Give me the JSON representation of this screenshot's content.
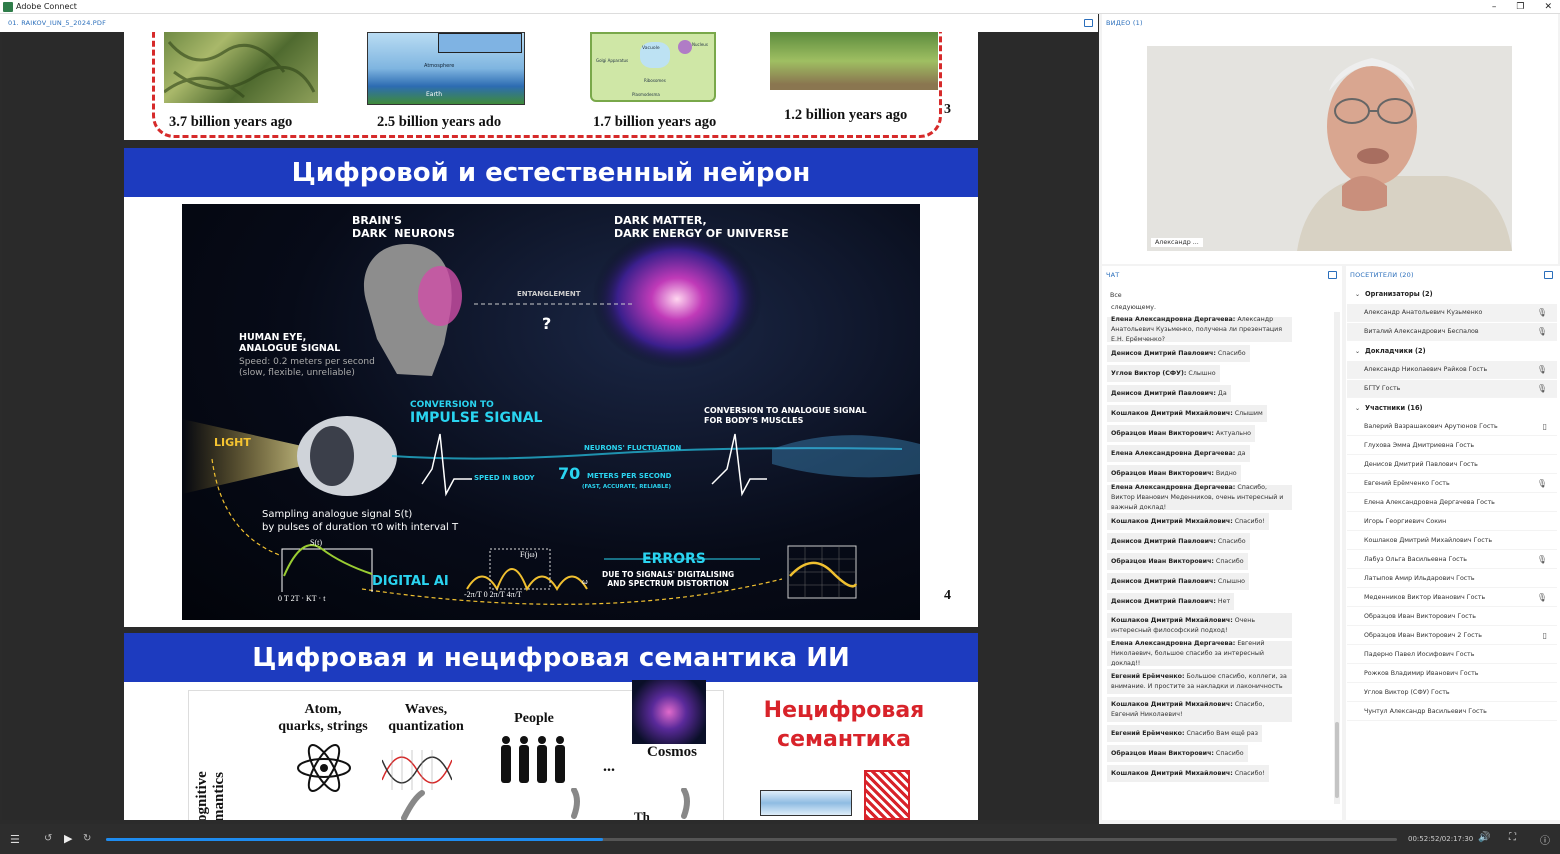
{
  "window": {
    "title": "Adobe Connect",
    "minimize": "–",
    "restore": "❐",
    "close": "✕"
  },
  "share_pod": {
    "title": "01. RAIKOV_IUN_5_2024.PDF"
  },
  "slide3": {
    "captions": [
      "3.7 billion years ago",
      "2.5 billion years ado",
      "1.7 billion years ago",
      "1.2 billion years ago"
    ],
    "page": "3",
    "diagram_labels": {
      "atmosphere": "Atmosphere",
      "earth": "Earth",
      "vacuole": "Vacuole",
      "golgi": "Golgi Apparatus",
      "nucleus": "Nucleus",
      "ribosomes": "Ribosomes",
      "plasmodesma": "Plasmodesma"
    }
  },
  "slide4": {
    "title": "Цифровой и естественный нейрон",
    "page": "4",
    "labels": {
      "brain": "BRAIN'S\nDARK  NEURONS",
      "matter": "DARK MATTER,\nDARK ENERGY OF UNIVERSE",
      "entanglement": "ENTANGLEMENT",
      "question": "?",
      "eye": "HUMAN EYE,\nANALOGUE SIGNAL",
      "eye_speed": "Speed: 0.2 meters per second\n(slow, flexible, unreliable)",
      "light": "LIGHT",
      "conv1": "CONVERSION TO",
      "conv2": "IMPULSE SIGNAL",
      "fluct": "NEURONS' FLUCTUATION",
      "speed1": "SPEED IN BODY",
      "speed2": "70",
      "speed3": "METERS PER SECOND",
      "speed4": "(FAST, ACCURATE, RELIABLE)",
      "conv3": "CONVERSION TO ANALOGUE SIGNAL\nFOR BODY'S MUSCLES",
      "sampling": "Sampling analogue signal S(t)\nby pulses of duration τ0 with interval T",
      "st": "S(t)",
      "axis": "0  T 2T  ·  KT ·  t",
      "digital": "DIGITAL AI",
      "fjw": "F(jω)",
      "freq": "-2π/T  0   2π/T  4π/T",
      "omega": "ω",
      "errors": "ERRORS",
      "errors_sub": "DUE TO SIGNALS' DIGITALISING\nAND SPECTRUM DISTORTION"
    }
  },
  "slide5": {
    "title": "Цифровая и нецифровая семантика ИИ",
    "items": [
      "Atom,\nquarks, strings",
      "Waves,\nquantization",
      "People",
      "Cosmos"
    ],
    "ellipsis": "...",
    "side_label": "ognitive\nmantics",
    "red": "Нецифровая\nсемантика",
    "bottom_partial": "Th"
  },
  "video_pod": {
    "title": "ВИДЕО (1)",
    "name_tag": "Александр ..."
  },
  "chat": {
    "title": "ЧАТ",
    "filter": "Все",
    "messages": [
      {
        "author": "",
        "text": "следующему."
      },
      {
        "author": "Елена Александровна Дергачева:",
        "text": " Александр Анатольевич Кузьменко, получена ли презентация Е.Н. Ерёмченко?"
      },
      {
        "author": "Денисов Дмитрий Павлович:",
        "text": " Спасибо"
      },
      {
        "author": "Углов Виктор (СФУ):",
        "text": " Слышно"
      },
      {
        "author": "Денисов Дмитрий Павлович:",
        "text": " Да"
      },
      {
        "author": "Кошлаков Дмитрий Михайлович:",
        "text": " Слышим"
      },
      {
        "author": "Образцов Иван Викторович:",
        "text": " Актуально"
      },
      {
        "author": "Елена Александровна Дергачева:",
        "text": " да"
      },
      {
        "author": "Образцов Иван Викторович:",
        "text": " Видно"
      },
      {
        "author": "Елена Александровна Дергачева:",
        "text": " Спасибо, Виктор Иванович Меденников, очень интересный и важный доклад!"
      },
      {
        "author": "Кошлаков Дмитрий Михайлович:",
        "text": " Спасибо!"
      },
      {
        "author": "Денисов Дмитрий Павлович:",
        "text": " Спасибо"
      },
      {
        "author": "Образцов Иван Викторович:",
        "text": " Спасибо"
      },
      {
        "author": "Денисов Дмитрий Павлович:",
        "text": " Слышно"
      },
      {
        "author": "Денисов Дмитрий Павлович:",
        "text": " Нет"
      },
      {
        "author": "Кошлаков Дмитрий Михайлович:",
        "text": " Очень интересный философский подход!"
      },
      {
        "author": "Елена Александровна Дергачева:",
        "text": " Евгений Николаевич, большое спасибо за интересный доклад!!"
      },
      {
        "author": "Евгений Ерёмченко:",
        "text": " Большое спасибо, коллеги, за внимание. И простите за накладки и лаконичность"
      },
      {
        "author": "Кошлаков Дмитрий Михайлович:",
        "text": " Спасибо, Евгений Николаевич!"
      },
      {
        "author": "Евгений Ерёмченко:",
        "text": " Спасибо Вам ещё раз"
      },
      {
        "author": "Образцов Иван Викторович:",
        "text": " Спасибо"
      },
      {
        "author": "Кошлаков Дмитрий Михайлович:",
        "text": " Спасибо!"
      }
    ]
  },
  "attendees": {
    "title": "ПОСЕТИТЕЛИ  (20)",
    "groups": [
      {
        "name": "Организаторы (2)",
        "people": [
          "Александр Анатольевич Кузьменко",
          "Виталий Александрович Беспалов"
        ]
      },
      {
        "name": "Докладчики (2)",
        "people": [
          "Александр Николаевич Райков  Гость",
          "БГТУ  Гость"
        ]
      },
      {
        "name": "Участники (16)",
        "people": [
          "Валерий Вазрашакович Арутюнов  Гость",
          "Глухова Эмма Дмитриевна  Гость",
          "Денисов Дмитрий Павлович  Гость",
          "Евгений Ерёмченко  Гость",
          "Елена Александровна Дергачева  Гость",
          "Игорь Георгиевич Сокин",
          "Кошлаков Дмитрий Михайлович  Гость",
          "Лабуз Ольга Васильевна  Гость",
          "Латыпов Амир Ильдарович  Гость",
          "Меденников Виктор Иванович  Гость",
          "Образцов Иван Викторович  Гость",
          "Образцов Иван Викторович 2  Гость",
          "Падерно Павел Иосифович  Гость",
          "Рожков Владимир Иванович  Гость",
          "Углов Виктор (СФУ)  Гость",
          "Чунтул Александр Васильевич  Гость"
        ]
      }
    ]
  },
  "playback": {
    "time": "00:52:52/02:17:30",
    "progress": 0.385
  },
  "colors": {
    "accent": "#2a6ebb",
    "banner": "#1d3bbf",
    "progress": "#1e8cf0",
    "dash": "#d62a2a"
  }
}
